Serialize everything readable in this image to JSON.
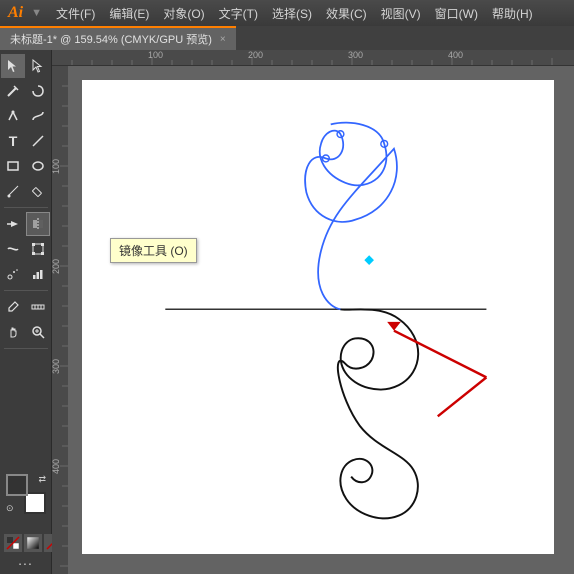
{
  "titlebar": {
    "logo": "Ai",
    "menu": [
      "文件(F)",
      "编辑(E)",
      "对象(O)",
      "文字(T)",
      "选择(S)",
      "效果(C)",
      "视图(V)",
      "窗口(W)",
      "帮助(H)"
    ]
  },
  "tab": {
    "title": "未标题-1* @ 159.54% (CMYK/GPU 预览)",
    "close": "×"
  },
  "tooltip": {
    "text": "镜像工具 (O)"
  },
  "toolbar": {
    "tools": [
      [
        "▲",
        "▶"
      ],
      [
        "✏",
        "🖊"
      ],
      [
        "✒",
        "✒"
      ],
      [
        "T",
        "╲"
      ],
      [
        "▭",
        "▭"
      ],
      [
        "✏",
        "◻"
      ],
      [
        "▶|",
        "⊞"
      ],
      [
        "◉",
        "◉"
      ],
      [
        "⊕",
        "⊕"
      ],
      [
        "▦",
        "▦"
      ],
      [
        "🔍",
        "⊙"
      ],
      [
        "✋",
        "🔍"
      ]
    ],
    "dots": "..."
  },
  "canvas": {
    "zoom": "159.54%",
    "mode": "CMYK/GPU 预览"
  }
}
